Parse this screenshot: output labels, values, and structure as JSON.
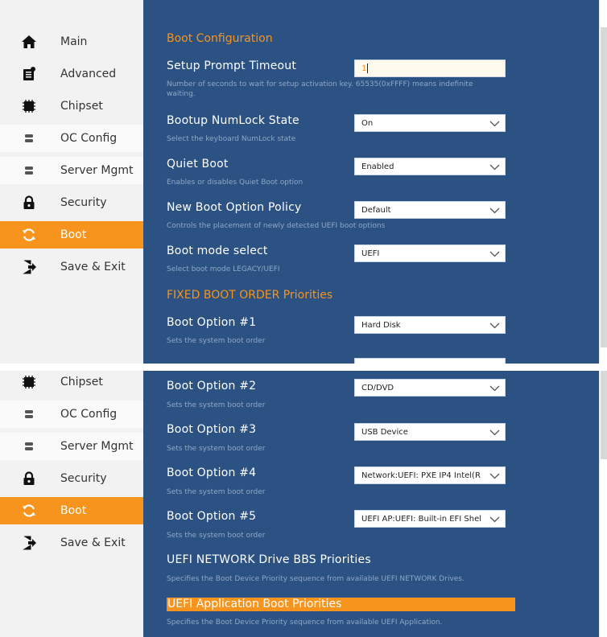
{
  "colors": {
    "accent": "#f7941d",
    "panel_bg": "#2b5282",
    "sidebar_bg": "#f2f2f2",
    "desc_text": "#8fa8c8"
  },
  "panel1": {
    "sidebar": [
      {
        "label": "Main",
        "icon": "home-icon"
      },
      {
        "label": "Advanced",
        "icon": "advanced-icon"
      },
      {
        "label": "Chipset",
        "icon": "chip-icon"
      },
      {
        "label": "OC Config",
        "icon": "server-icon"
      },
      {
        "label": "Server Mgmt",
        "icon": "server-icon"
      },
      {
        "label": "Security",
        "icon": "lock-icon"
      },
      {
        "label": "Boot",
        "icon": "refresh-icon",
        "selected": true
      },
      {
        "label": "Save & Exit",
        "icon": "exit-icon"
      }
    ],
    "section_title": "Boot Configuration",
    "setup_prompt": {
      "label": "Setup Prompt Timeout",
      "value": "1",
      "desc_line1": "Number of seconds to wait for setup activation key. 65535(0xFFFF) means indefinite",
      "desc_line2": "waiting."
    },
    "numlock": {
      "label": "Bootup NumLock State",
      "value": "On",
      "desc": "Select the keyboard NumLock state"
    },
    "quiet_boot": {
      "label": "Quiet Boot",
      "value": "Enabled",
      "desc": "Enables or disables Quiet Boot option"
    },
    "new_boot_policy": {
      "label": "New Boot Option Policy",
      "value": "Default",
      "desc": "Controls the placement of newly detected UEFI boot options"
    },
    "boot_mode": {
      "label": "Boot mode select",
      "value": "UEFI",
      "desc": "Select boot mode LEGACY/UEFI"
    },
    "fixed_title": "FIXED BOOT ORDER Priorities",
    "boot_option1": {
      "label": "Boot Option #1",
      "value": "Hard Disk",
      "desc": "Sets the system boot order"
    }
  },
  "panel2": {
    "sidebar": [
      {
        "label": "Chipset",
        "icon": "chip-icon"
      },
      {
        "label": "OC Config",
        "icon": "server-icon"
      },
      {
        "label": "Server Mgmt",
        "icon": "server-icon"
      },
      {
        "label": "Security",
        "icon": "lock-icon"
      },
      {
        "label": "Boot",
        "icon": "refresh-icon",
        "selected": true
      },
      {
        "label": "Save & Exit",
        "icon": "exit-icon"
      }
    ],
    "boot_option2": {
      "label": "Boot Option #2",
      "value": "CD/DVD",
      "desc": "Sets the system boot order"
    },
    "boot_option3": {
      "label": "Boot Option #3",
      "value": "USB Device",
      "desc": "Sets the system boot order"
    },
    "boot_option4": {
      "label": "Boot Option #4",
      "value": "Network:UEFI: PXE IP4 Intel(R",
      "desc": "Sets the system boot order"
    },
    "boot_option5": {
      "label": "Boot Option #5",
      "value": "UEFI AP:UEFI: Built-in EFI Shel",
      "desc": "Sets the system boot order"
    },
    "uefi_network": {
      "label": "UEFI NETWORK Drive BBS Priorities",
      "desc": "Specifies the Boot Device Priority sequence from available UEFI NETWORK Drives."
    },
    "uefi_app": {
      "label": "UEFI Application Boot Priorities",
      "desc": "Specifies the Boot Device Priority sequence from available UEFI Application."
    }
  }
}
